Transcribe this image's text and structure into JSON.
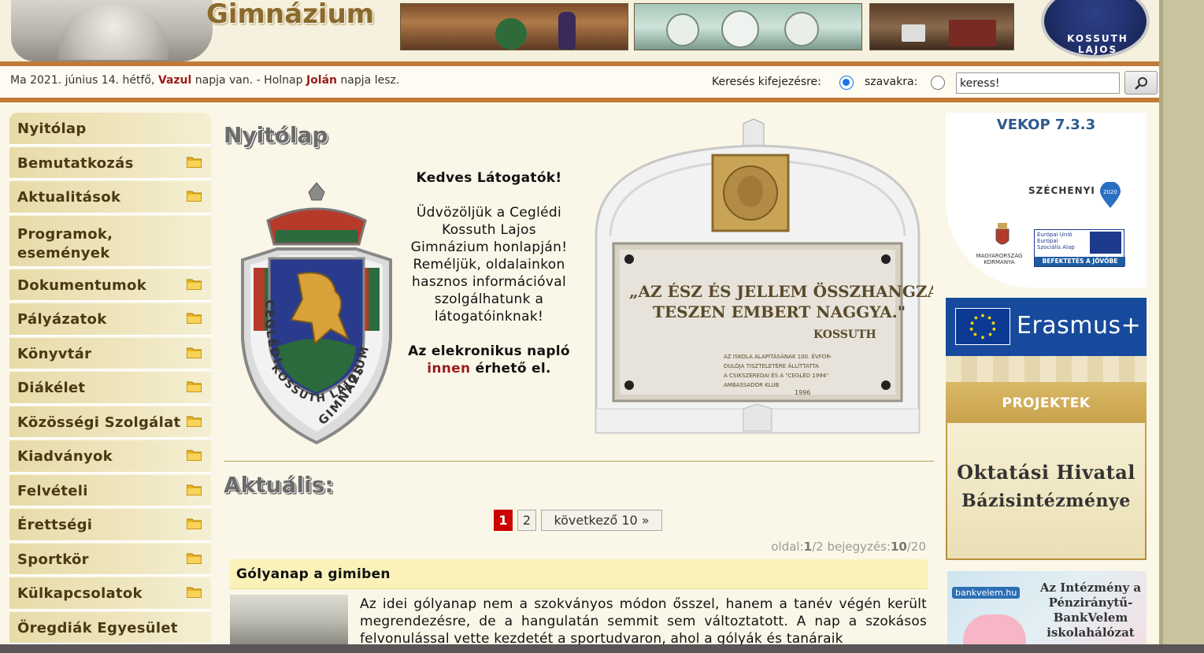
{
  "header": {
    "site_title": "Gimnázium",
    "crest_text": "KOSSUTH LAJOS"
  },
  "infobar": {
    "date_prefix": "Ma 2021. június 14. hétfő, ",
    "today_name": "Vazul",
    "mid_text": " napja van. - Holnap ",
    "tomorrow_name": "Jolán",
    "suffix": " napja lesz.",
    "search": {
      "label_phrase": "Keresés kifejezésre:",
      "label_words": "szavakra:",
      "phrase_selected": true,
      "input_value": "keress!"
    }
  },
  "sidebar": {
    "items": [
      {
        "label": "Nyitólap",
        "folder": false
      },
      {
        "label": "Bemutatkozás",
        "folder": true
      },
      {
        "label": "Aktualitások",
        "folder": true
      },
      {
        "label": "Programok, események",
        "folder": false
      },
      {
        "label": "Dokumentumok",
        "folder": true
      },
      {
        "label": "Pályázatok",
        "folder": true
      },
      {
        "label": "Könyvtár",
        "folder": true
      },
      {
        "label": "Diákélet",
        "folder": true
      },
      {
        "label": "Közösségi Szolgálat",
        "folder": true
      },
      {
        "label": "Kiadványok",
        "folder": true
      },
      {
        "label": "Felvételi",
        "folder": true
      },
      {
        "label": "Érettségi",
        "folder": true
      },
      {
        "label": "Sportkör",
        "folder": true
      },
      {
        "label": "Külkapcsolatok",
        "folder": true
      },
      {
        "label": "Öregdiák Egyesület",
        "folder": false
      }
    ]
  },
  "main": {
    "page_title": "Nyitólap",
    "badge": {
      "arc_left": "CEGLÉDI",
      "arc_bottom": "KOSSUTH LAJOS",
      "arc_right": "GIMNÁZIUM"
    },
    "welcome": {
      "heading": "Kedves Látogatók!",
      "body": "Üdvözöljük a Ceglédi Kossuth Lajos Gimnázium honlapján! Reméljük, oldalainkon hasznos információval szolgálhatunk a látogatóinknak!",
      "naplo_before": "Az elekronikus napló ",
      "naplo_link": "innen",
      "naplo_after": " érhető el."
    },
    "plaque": {
      "quote_line1": "„AZ ÉSZ ÉS JELLEM ÖSSZHANGZATA",
      "quote_line2": "TESZEN EMBERT NAGGYA.\"",
      "author": "KOSSUTH",
      "small_line1": "AZ ISKOLA ALAPÍTÁSÁNAK 100. ÉVFOR-",
      "small_line2": "DULÓJA TISZTELETÉRE ÁLLÍTTATTA",
      "small_line3": "A CSIKSZEREDAI ÉS A \"CEGLÉD 1994\"",
      "small_line4": "AMBASSADOR KLUB",
      "year": "1996"
    },
    "section_title": "Aktuális:",
    "pager": {
      "current": "1",
      "page2": "2",
      "next_label": "következő 10 »"
    },
    "pageinfo": {
      "oldal_label": "oldal:",
      "oldal_cur": "1",
      "oldal_total": "/2",
      "bejegyzes_label": " bejegyzés:",
      "bejegyzes_cur": "10",
      "bejegyzes_total": "/20"
    },
    "post": {
      "title": "Gólyanap a gimiben",
      "text": "Az idei gólyanap nem a szokványos módon ősszel, hanem a tanév végén került megrendezésre, de a hangulatán semmit sem változtatott. A nap a szokásos felvonulással vette kezdetét a sportudvaron, ahol a gólyák és tanáraik"
    }
  },
  "rightcol": {
    "vekop_title": "VEKOP 7.3.3",
    "szechenyi": "SZÉCHENYI",
    "szechenyi_year": "2020",
    "eu_title": "Európai Unió Európai Szociális Alap",
    "eu_bottom": "BEFEKTETÉS A JÖVŐBE",
    "magyarorszag": "MAGYARORSZÁG KORMÁNYA",
    "erasmus": "Erasmus+",
    "projektek": "PROJEKTEK",
    "oh_line1": "Oktatási Hivatal",
    "oh_line2": "Bázisintézménye",
    "bank_text": "Az Intézmény a Pénziránytű-BankVelem iskolahálózat",
    "bank_logo": "bankvelem.hu"
  },
  "colors": {
    "accent_red": "#9b1b1b",
    "stripe": "#c07b38",
    "nav_text": "#4a3a14",
    "pager_active": "#cc0000"
  }
}
